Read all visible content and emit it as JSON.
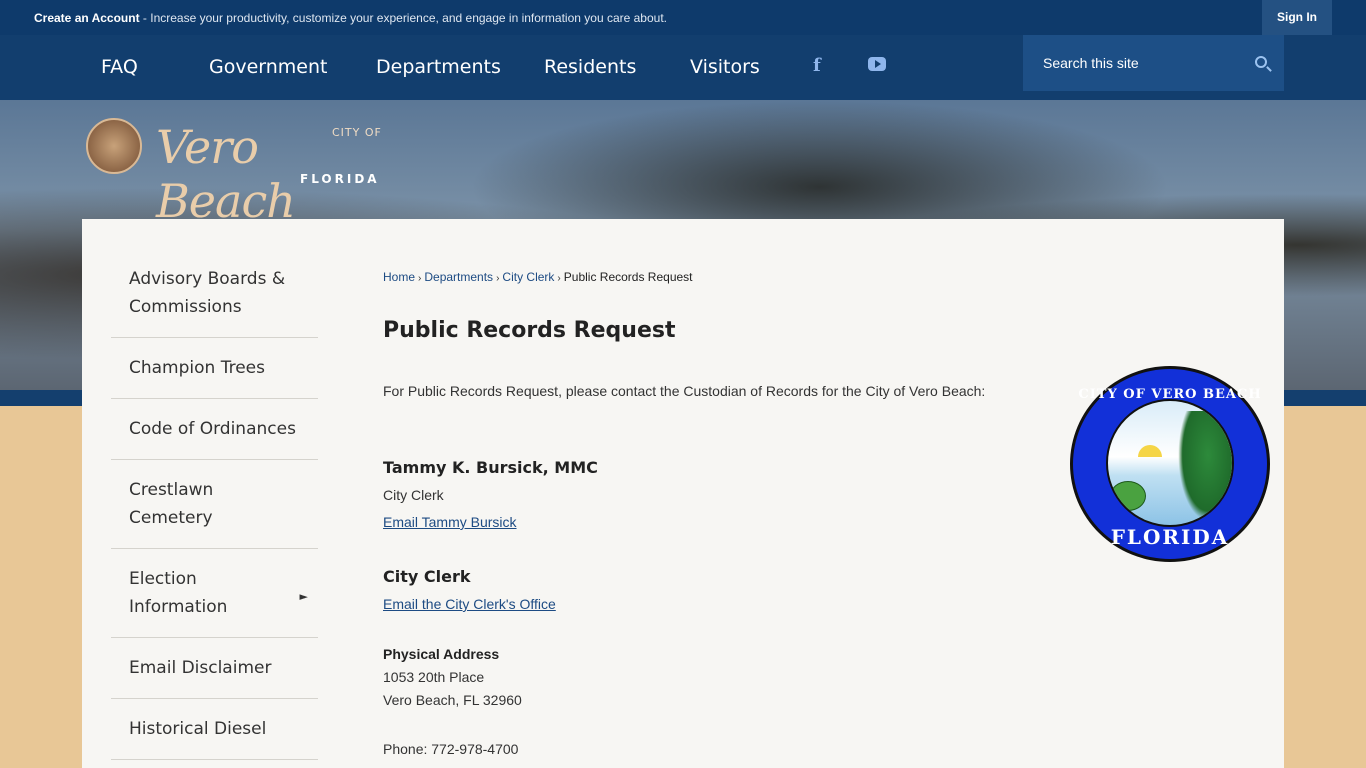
{
  "topbar": {
    "create_account": "Create an Account",
    "message": " - Increase your productivity, customize your experience, and engage in information you care about.",
    "sign_in": "Sign In"
  },
  "nav": {
    "items": [
      "FAQ",
      "Government",
      "Departments",
      "Residents",
      "Visitors"
    ],
    "social": {
      "facebook": "f",
      "youtube_icon": "youtube-icon"
    },
    "search_placeholder": "Search this site"
  },
  "logo": {
    "city_of": "CITY OF",
    "name": "Vero Beach",
    "state": "FLORIDA"
  },
  "sidebar": {
    "items": [
      {
        "label": "Advisory Boards & Commissions"
      },
      {
        "label": "Champion Trees"
      },
      {
        "label": "Code of Ordinances"
      },
      {
        "label": "Crestlawn Cemetery"
      },
      {
        "label": "Election Information",
        "has_submenu": true
      },
      {
        "label": "Email Disclaimer"
      },
      {
        "label": "Historical Diesel"
      }
    ]
  },
  "breadcrumb": {
    "items": [
      "Home",
      "Departments",
      "City Clerk"
    ],
    "current": "Public Records Request"
  },
  "page": {
    "title": "Public Records Request",
    "intro": "For Public Records Request, please contact the Custodian of Records for the City of Vero Beach:",
    "contact1": {
      "name": "Tammy K. Bursick, MMC",
      "role": "City Clerk",
      "email_link": "Email Tammy Bursick"
    },
    "contact2": {
      "name": "City Clerk",
      "email_link": "Email the City Clerk's Office"
    },
    "address": {
      "label": "Physical Address",
      "line1": "1053 20th Place",
      "line2": "Vero Beach, FL 32960"
    },
    "phone": "Phone: 772-978-4700"
  },
  "seal": {
    "top_text": "CITY OF VERO BEACH",
    "bottom_text": "FLORIDA"
  },
  "colors": {
    "topbar": "#0e3a6b",
    "nav": "#123e6e",
    "search_bg": "#1d4f86",
    "link": "#1d4b83",
    "page_bg": "#e8c796",
    "card_bg": "#f7f6f3"
  }
}
